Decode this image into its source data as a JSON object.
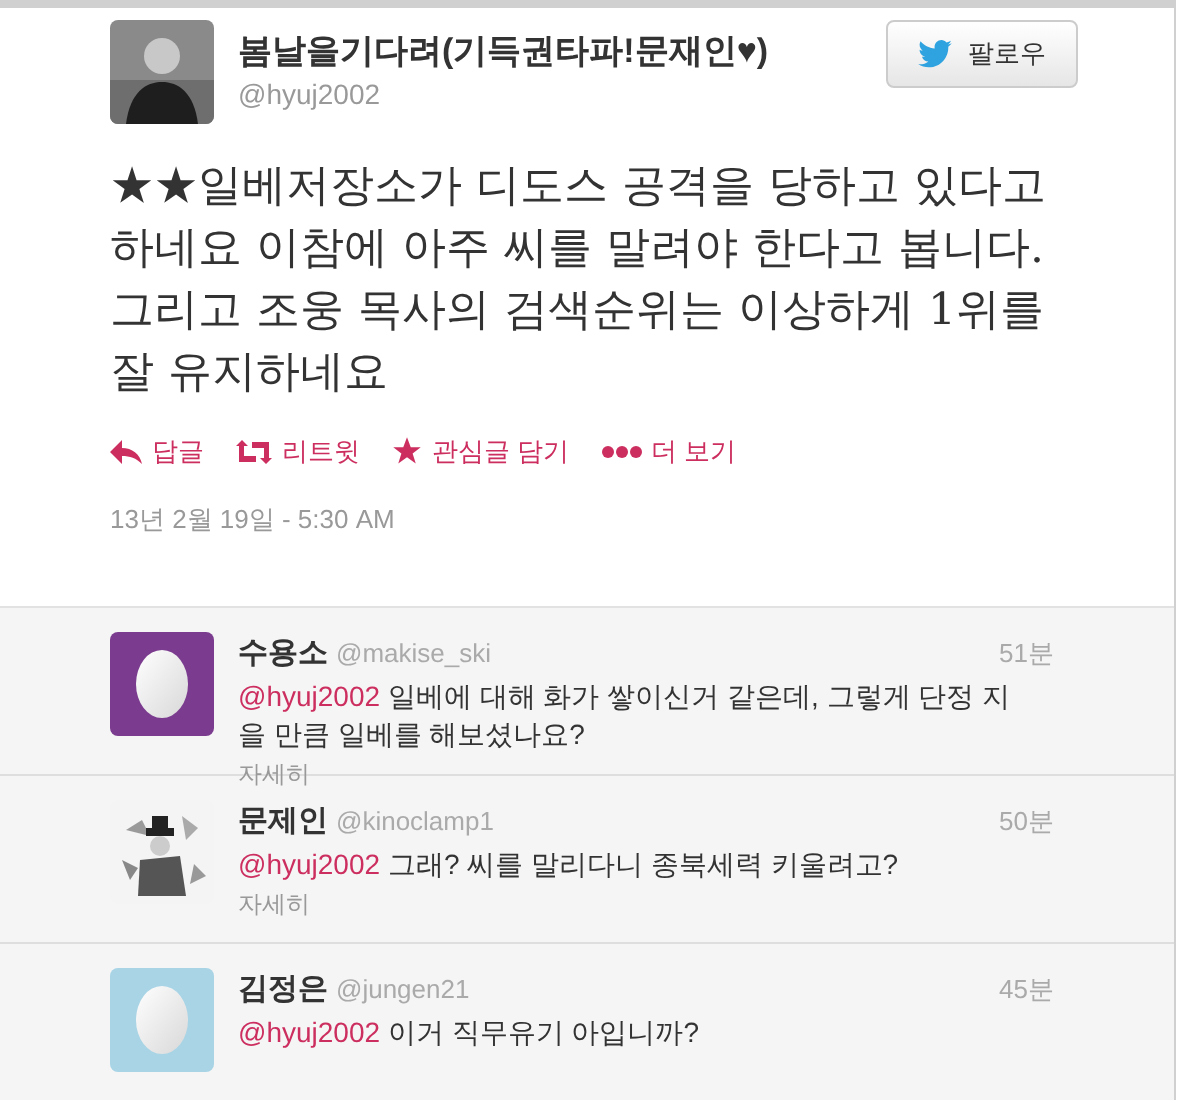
{
  "tweet": {
    "name": "봄날을기다려(기득권타파!문재인♥)",
    "handle": "@hyuj2002",
    "follow_button": "팔로우",
    "text": "★★일베저장소가 디도스 공격을 당하고 있다고 하네요 이참에 아주 씨를 말려야 한다고 봅니다. 그리고 조웅 목사의 검색순위는 이상하게 1위를 잘 유지하네요",
    "actions": [
      {
        "kind": "reply",
        "label": "답글"
      },
      {
        "kind": "retweet",
        "label": "리트윗"
      },
      {
        "kind": "favorite",
        "label": "관심글 담기"
      },
      {
        "kind": "more",
        "label": "더 보기"
      }
    ],
    "timestamp": "13년 2월 19일 - 5:30 AM"
  },
  "replies": [
    {
      "avatar": {
        "kind": "egg",
        "color": "#7b3b8f"
      },
      "name": "수용소",
      "handle": "@makise_ski",
      "time": "51분",
      "mention": "@hyuj2002",
      "text": "일베에 대해 화가 쌓이신거 같은데, 그렇게 단정 지을 만큼 일베를 해보셨나요?",
      "details": "자세히"
    },
    {
      "name": "문제인",
      "handle": "@kinoclamp1",
      "time": "50분",
      "mention": "@hyuj2002",
      "text": "그래? 씨를 말리다니 종북세력 키울려고?",
      "details": "자세히"
    },
    {
      "avatar": {
        "kind": "egg",
        "color": "#a8d4e6"
      },
      "name": "김정은",
      "handle": "@jungen21",
      "time": "45분",
      "mention": "@hyuj2002",
      "text": "이거 직무유기 아입니까?"
    }
  ]
}
